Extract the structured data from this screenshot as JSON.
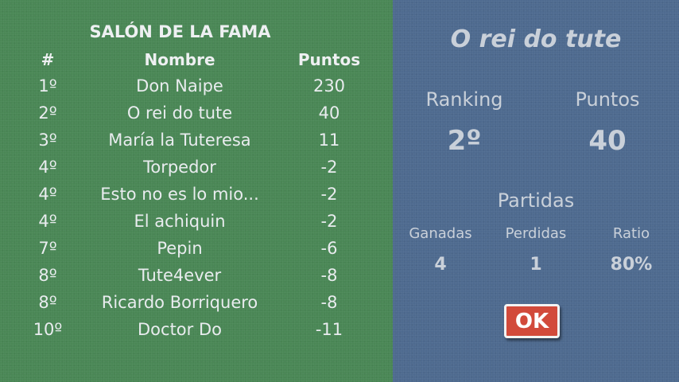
{
  "hall_of_fame": {
    "title": "SALÓN DE LA FAMA",
    "columns": {
      "rank": "#",
      "name": "Nombre",
      "points": "Puntos"
    },
    "rows": [
      {
        "rank": "1º",
        "name": "Don Naipe",
        "points": "230"
      },
      {
        "rank": "2º",
        "name": "O rei do tute",
        "points": "40"
      },
      {
        "rank": "3º",
        "name": "María la Tuteresa",
        "points": "11"
      },
      {
        "rank": "4º",
        "name": "Torpedor",
        "points": "-2"
      },
      {
        "rank": "4º",
        "name": "Esto no es lo mio...",
        "points": "-2"
      },
      {
        "rank": "4º",
        "name": "El achiquin",
        "points": "-2"
      },
      {
        "rank": "7º",
        "name": "Pepin",
        "points": "-6"
      },
      {
        "rank": "8º",
        "name": "Tute4ever",
        "points": "-8"
      },
      {
        "rank": "8º",
        "name": "Ricardo Borriquero",
        "points": "-8"
      },
      {
        "rank": "10º",
        "name": "Doctor Do",
        "points": "-11"
      }
    ]
  },
  "player": {
    "name": "O rei do tute",
    "ranking_label": "Ranking",
    "ranking_value": "2º",
    "points_label": "Puntos",
    "points_value": "40",
    "games_label": "Partidas",
    "won_label": "Ganadas",
    "won_value": "4",
    "lost_label": "Perdidas",
    "lost_value": "1",
    "ratio_label": "Ratio",
    "ratio_value": "80%"
  },
  "ok_button": {
    "label": "OK"
  },
  "colors": {
    "left_panel": "#4a8755",
    "right_panel": "#4e6a8f",
    "ok_button": "#d24a3b"
  }
}
